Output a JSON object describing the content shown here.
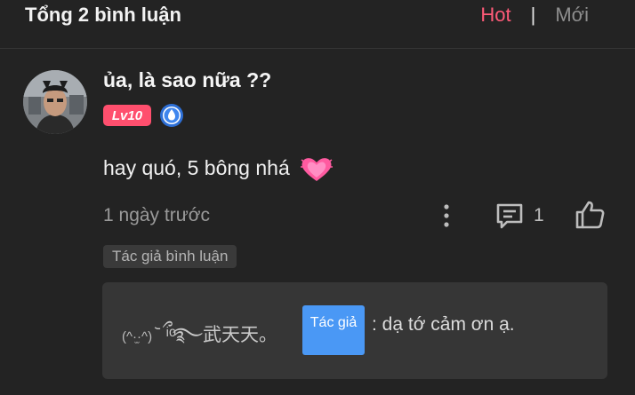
{
  "header": {
    "title": "Tổng 2 bình luận",
    "sort_hot": "Hot",
    "sort_separator": "|",
    "sort_new": "Mới"
  },
  "comment": {
    "username": "ủa, là sao nữa ??",
    "level": "Lv10",
    "text": "hay quó, 5 bông nhá",
    "emoji": "heart-icon",
    "time": "1 ngày trước",
    "reply_count": "1",
    "author_tag": "Tác giả bình luận"
  },
  "reply": {
    "name_kaomoji": "(^·̫·^)",
    "name_rest": " ᷅ ྀ ͥ ͦ࿐武天天。",
    "author_badge": "Tác giả",
    "text": ": dạ tớ cảm ơn ạ."
  },
  "colors": {
    "background": "#232323",
    "accent_hot": "#ff5b78",
    "level_badge": "#ff4f6e",
    "author_badge": "#4a98f5",
    "reply_box": "#363636"
  }
}
